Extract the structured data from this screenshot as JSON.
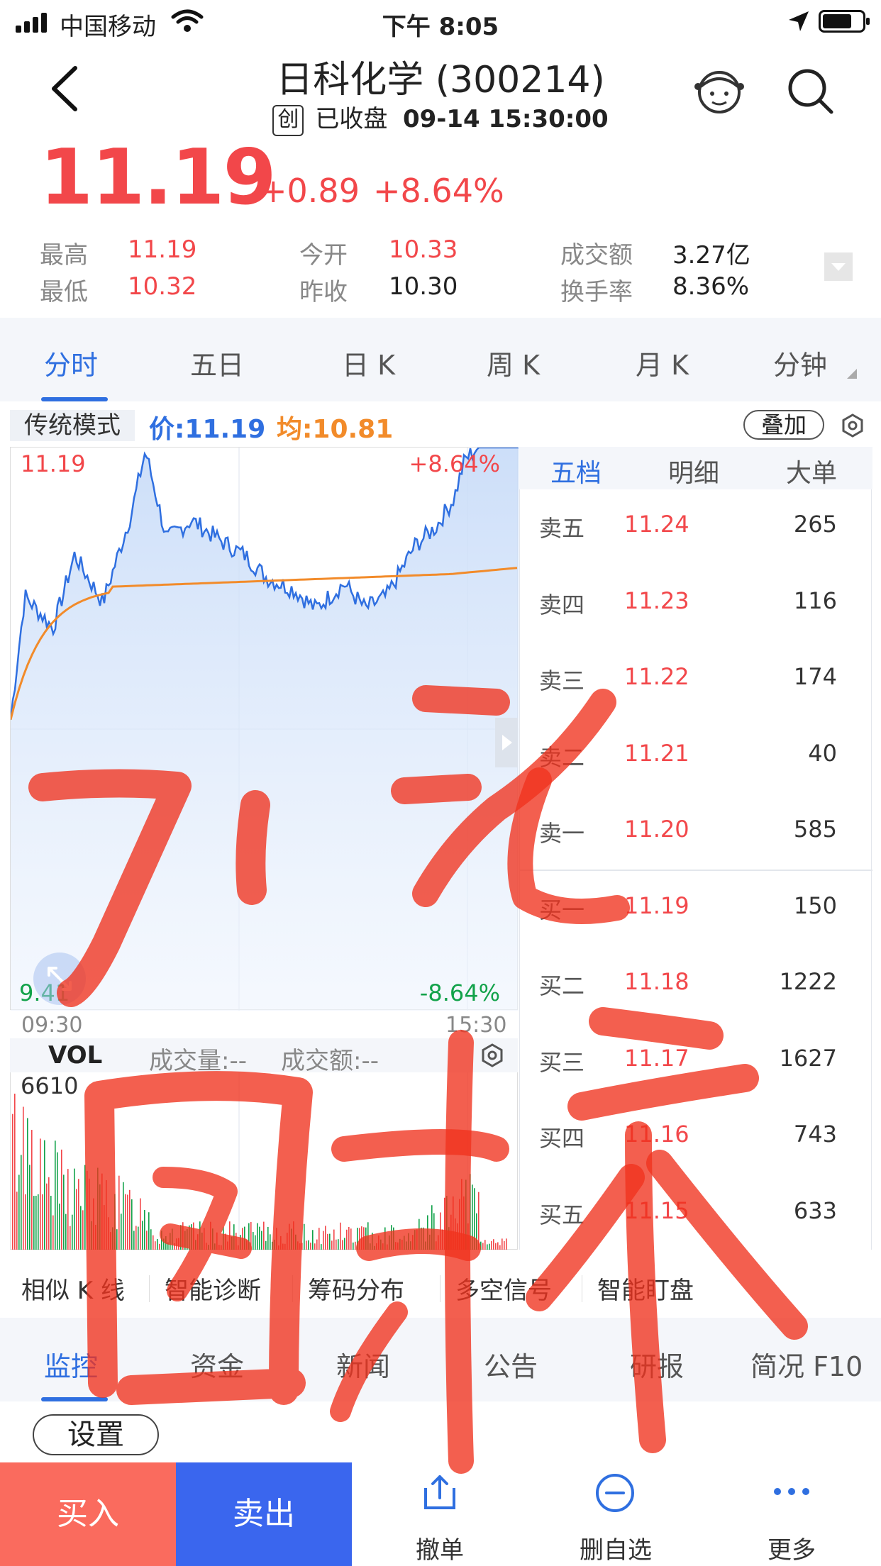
{
  "status_bar": {
    "carrier": "中国移动",
    "time": "下午 8:05"
  },
  "header": {
    "title": "日科化学 (300214)",
    "board_tag": "创",
    "market_status": "已收盘",
    "timestamp": "09-14 15:30:00"
  },
  "quote": {
    "price": "11.19",
    "change": "+0.89",
    "change_pct": "+8.64%",
    "high_label": "最高",
    "high": "11.19",
    "low_label": "最低",
    "low": "10.32",
    "open_label": "今开",
    "open": "10.33",
    "prev_label": "昨收",
    "prev_close": "10.30",
    "amount_label": "成交额",
    "amount": "3.27亿",
    "turnover_label": "换手率",
    "turnover": "8.36%"
  },
  "period_tabs": [
    {
      "label": "分时",
      "active": true
    },
    {
      "label": "五日",
      "active": false
    },
    {
      "label": "日 K",
      "active": false
    },
    {
      "label": "周 K",
      "active": false
    },
    {
      "label": "月 K",
      "active": false
    },
    {
      "label": "分钟",
      "active": false
    }
  ],
  "chart_toolbar": {
    "mode": "传统模式",
    "price_label": "价:11.19",
    "avg_label": "均:10.81",
    "overlay": "叠加"
  },
  "chart_labels": {
    "top_price": "11.19",
    "top_pct": "+8.64%",
    "bottom_price": "9.41",
    "bottom_pct": "-8.64%",
    "time_start": "09:30",
    "time_end": "15:30",
    "vol_title": "VOL",
    "vol_qty": "成交量:--",
    "vol_amount": "成交额:--",
    "vol_max": "6610"
  },
  "orderbook_tabs": [
    "五档",
    "明细",
    "大单"
  ],
  "orderbook": [
    {
      "side": "卖五",
      "price": "11.24",
      "vol": "265"
    },
    {
      "side": "卖四",
      "price": "11.23",
      "vol": "116"
    },
    {
      "side": "卖三",
      "price": "11.22",
      "vol": "174"
    },
    {
      "side": "卖二",
      "price": "11.21",
      "vol": "40"
    },
    {
      "side": "卖一",
      "price": "11.20",
      "vol": "585"
    },
    {
      "side": "买一",
      "price": "11.19",
      "vol": "150"
    },
    {
      "side": "买二",
      "price": "11.18",
      "vol": "1222"
    },
    {
      "side": "买三",
      "price": "11.17",
      "vol": "1627"
    },
    {
      "side": "买四",
      "price": "11.16",
      "vol": "743"
    },
    {
      "side": "买五",
      "price": "11.15",
      "vol": "633"
    }
  ],
  "tools": [
    "相似 K 线",
    "智能诊断",
    "筹码分布",
    "多空信号",
    "智能盯盘"
  ],
  "info_tabs": [
    {
      "label": "监控",
      "active": true
    },
    {
      "label": "资金",
      "active": false
    },
    {
      "label": "新闻",
      "active": false
    },
    {
      "label": "公告",
      "active": false
    },
    {
      "label": "研报",
      "active": false
    },
    {
      "label": "简况 F10",
      "active": false
    }
  ],
  "settings_label": "设置",
  "footer": {
    "buy": "买入",
    "sell": "卖出",
    "cancel": "撤单",
    "remove_watch": "删自选",
    "more": "更多"
  },
  "colors": {
    "up": "#f2474a",
    "down": "#12a24a",
    "accent": "#2f6fe0",
    "avg_line": "#f28b2a",
    "buy_btn": "#fa6b5e",
    "sell_btn": "#3a66ee"
  },
  "handwriting": "7'元 回补"
}
